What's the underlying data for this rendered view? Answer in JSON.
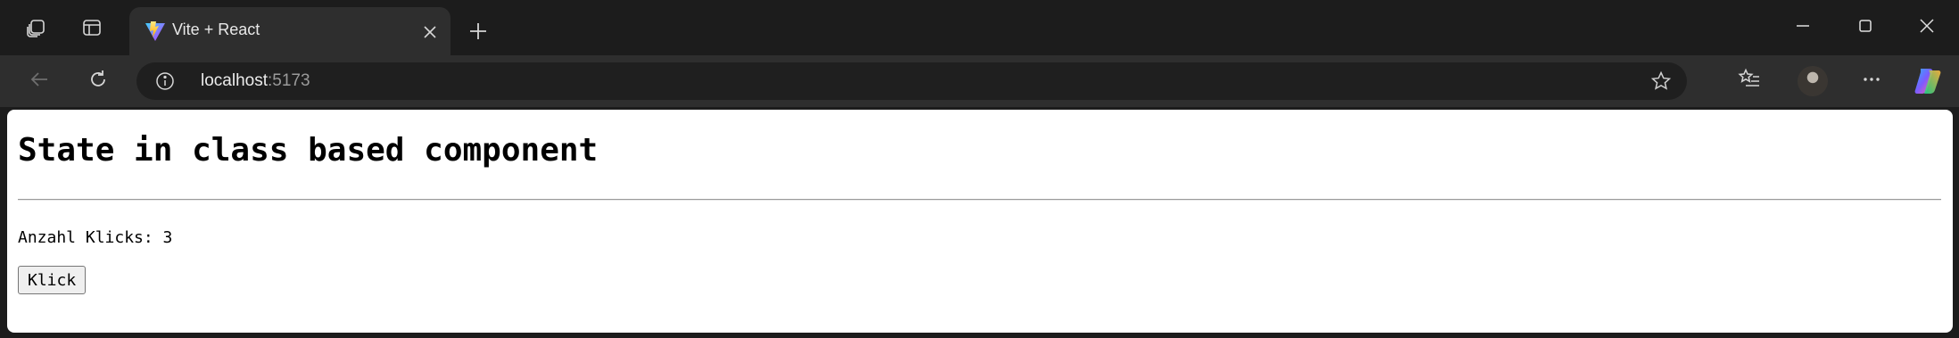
{
  "browser": {
    "tab": {
      "title": "Vite + React"
    },
    "address_bar": {
      "host": "localhost",
      "port": ":5173"
    },
    "icons": {
      "workspaces": "workspaces-icon",
      "tab_actions": "tab-actions-icon",
      "favicon": "vite-logo-icon",
      "tab_close": "close-icon",
      "new_tab": "plus-icon",
      "minimize": "minimize-icon",
      "maximize": "maximize-icon",
      "close_window": "close-window-icon",
      "back": "back-arrow-icon",
      "refresh": "refresh-icon",
      "site_info": "info-icon",
      "favorite": "star-icon",
      "favorites": "favorites-list-icon",
      "profile": "avatar",
      "more": "more-icon",
      "copilot": "copilot-icon"
    },
    "theme": {
      "frame": "#1c1c1c",
      "toolbar": "#2e2e2e",
      "address_bg": "#1f1f1f"
    }
  },
  "page": {
    "heading": "State in class based component",
    "counter_text": "Anzahl Klicks: 3",
    "button_label": "Klick"
  }
}
